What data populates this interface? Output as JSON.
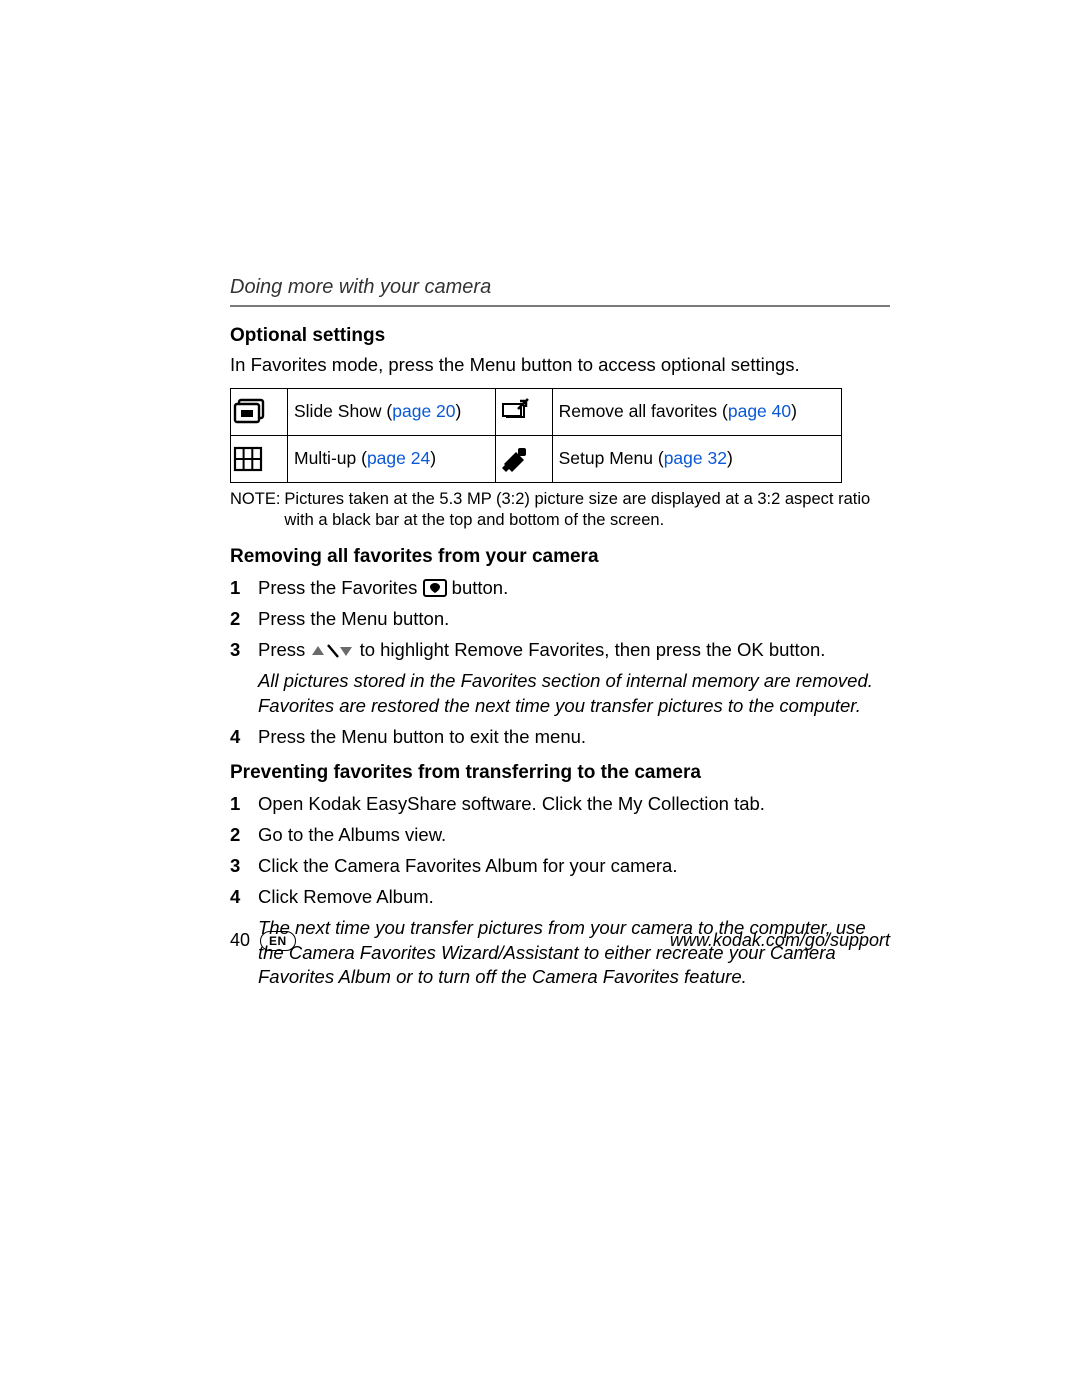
{
  "running_head": "Doing more with your camera",
  "section1": {
    "title": "Optional settings",
    "intro": "In Favorites mode, press the Menu button to access optional settings."
  },
  "table": {
    "r1c1": {
      "label": "Slide Show (",
      "link": "page 20",
      "close": ")"
    },
    "r1c2": {
      "label": "Remove all favorites (",
      "link": "page 40",
      "close": ")"
    },
    "r2c1": {
      "label": "Multi-up (",
      "link": "page 24",
      "close": ")"
    },
    "r2c2": {
      "label": "Setup Menu (",
      "link": "page 32",
      "close": ")"
    }
  },
  "note": {
    "label": "NOTE:",
    "text": "Pictures taken at the 5.3 MP (3:2) picture size are displayed at a 3:2 aspect ratio with a black bar at the top and bottom of the screen."
  },
  "section2": {
    "title": "Removing all favorites from your camera",
    "steps": [
      {
        "num": "1",
        "pre": "Press the Favorites ",
        "post": " button."
      },
      {
        "num": "2",
        "text": "Press the Menu button."
      },
      {
        "num": "3",
        "pre": "Press ",
        "post": " to highlight Remove Favorites, then press the OK button.",
        "italic": "All pictures stored in the Favorites section of internal memory are removed. Favorites are restored the next time you transfer pictures to the computer."
      },
      {
        "num": "4",
        "text": "Press the Menu button to exit the menu."
      }
    ]
  },
  "section3": {
    "title": "Preventing favorites from transferring to the camera",
    "steps": [
      {
        "num": "1",
        "text": "Open Kodak EasyShare software. Click the My Collection tab."
      },
      {
        "num": "2",
        "text": "Go to the Albums view."
      },
      {
        "num": "3",
        "text": "Click the Camera Favorites Album for your camera."
      },
      {
        "num": "4",
        "text": "Click Remove Album.",
        "italic": "The next time you transfer pictures from your camera to the computer, use the Camera Favorites Wizard/Assistant to either recreate your Camera Favorites Album or to turn off the Camera Favorites feature."
      }
    ]
  },
  "footer": {
    "page": "40",
    "lang": "EN",
    "url": "www.kodak.com/go/support"
  }
}
